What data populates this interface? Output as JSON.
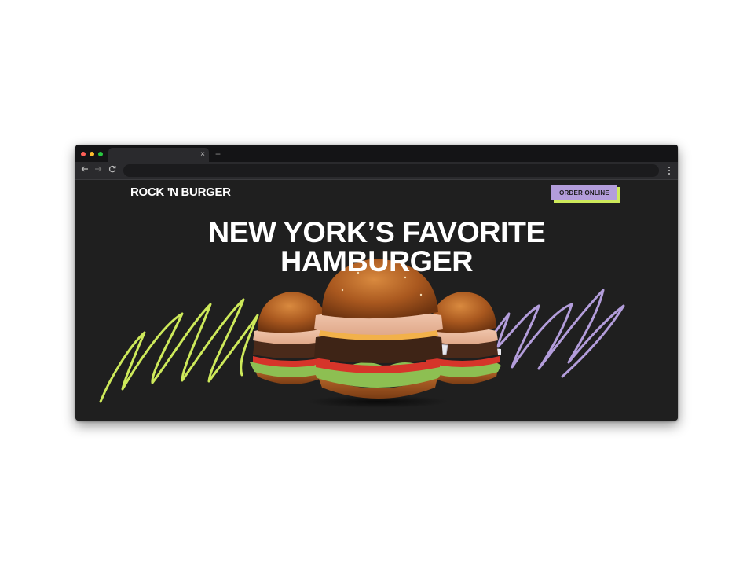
{
  "browser": {
    "tab_close": "×",
    "new_tab": "+",
    "back_icon": "arrow-left-icon",
    "forward_icon": "arrow-right-icon",
    "reload_icon": "reload-icon",
    "menu_icon": "kebab-menu-icon"
  },
  "site": {
    "logo": "ROCK 'N BURGER",
    "order_button": "ORDER ONLINE",
    "headline_line1": "NEW YORK’S FAVORITE",
    "headline_line2": "HAMBURGER"
  },
  "hero": {
    "image": "three-burgers-image",
    "scribble_left_color": "#cde95a",
    "scribble_right_color": "#b39ddb",
    "background": "#1f1f1f"
  },
  "colors": {
    "accent_purple": "#b39ddb",
    "accent_lime": "#cde95a"
  }
}
